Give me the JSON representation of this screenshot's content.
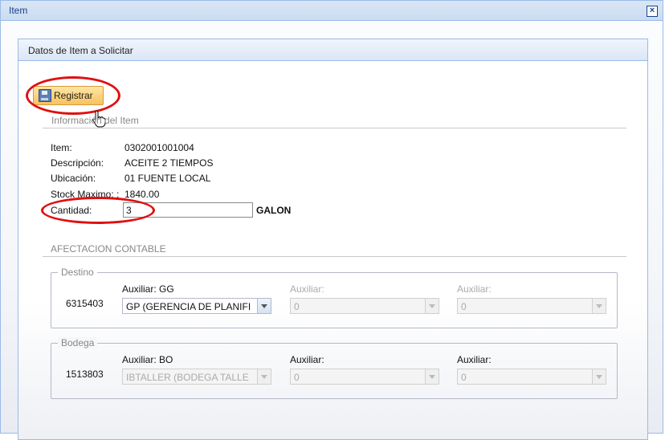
{
  "window": {
    "title": "Item",
    "close_icon": "close-icon"
  },
  "panel": {
    "title": "Datos de Item a Solicitar"
  },
  "toolbar": {
    "register_label": "Registrar",
    "register_icon": "save-icon"
  },
  "info": {
    "section_title": "Información del Item",
    "item_label": "Item:",
    "item_value": "0302001001004",
    "desc_label": "Descripción:",
    "desc_value": "ACEITE 2 TIEMPOS",
    "loc_label": "Ubicación:",
    "loc_value": "01 FUENTE LOCAL",
    "stock_label": "Stock Maximo: :",
    "stock_value": "1840.00",
    "qty_label": "Cantidad:",
    "qty_value": "3",
    "qty_unit": "GALON"
  },
  "afectacion": {
    "section_title": "AFECTACION CONTABLE",
    "destino": {
      "legend": "Destino",
      "code": "6315403",
      "aux1_label": "Auxiliar: GG",
      "aux1_value": "GP (GERENCIA DE PLANIFI",
      "aux2_label": "Auxiliar:",
      "aux2_value": "0",
      "aux3_label": "Auxiliar:",
      "aux3_value": "0"
    },
    "bodega": {
      "legend": "Bodega",
      "code": "1513803",
      "aux1_label": "Auxiliar: BO",
      "aux1_value": "IBTALLER (BODEGA TALLE",
      "aux2_label": "Auxiliar:",
      "aux2_value": "0",
      "aux3_label": "Auxiliar:",
      "aux3_value": "0"
    }
  },
  "colors": {
    "highlight_ring": "#e01010",
    "button_bg": "#f7c25e",
    "header_text": "#15428b"
  }
}
